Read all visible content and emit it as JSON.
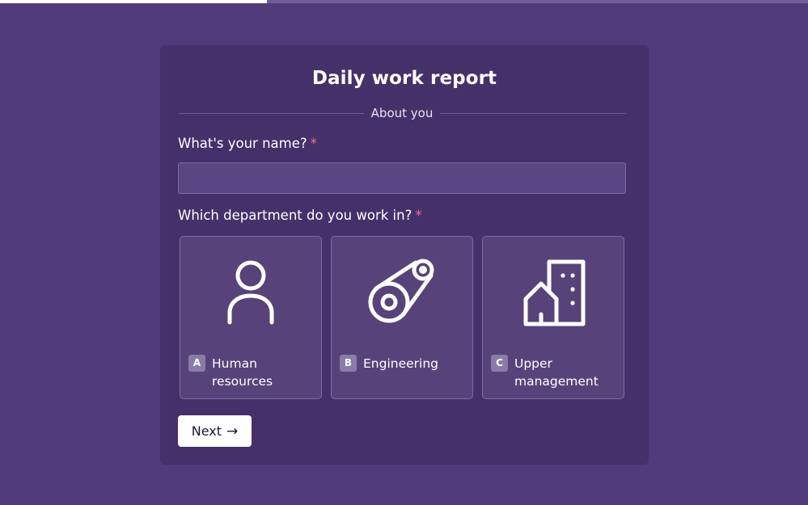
{
  "progress": {
    "fraction": 0.33
  },
  "form": {
    "title": "Daily work report",
    "section_label": "About you",
    "name_question": {
      "text": "What's your name?",
      "required_mark": "*",
      "input_value": "",
      "input_placeholder": ""
    },
    "department_question": {
      "text": "Which department do you work in?",
      "required_mark": "*"
    },
    "options": [
      {
        "key": "A",
        "label": "Human resources",
        "icon": "person-icon"
      },
      {
        "key": "B",
        "label": "Engineering",
        "icon": "pulley-icon"
      },
      {
        "key": "C",
        "label": "Upper management",
        "icon": "building-icon"
      }
    ],
    "next_button": {
      "label": "Next",
      "arrow": "→"
    }
  },
  "colors": {
    "background": "#513b7a",
    "card": "#45306a",
    "required": "#f0708f",
    "button": "#ffffff"
  }
}
